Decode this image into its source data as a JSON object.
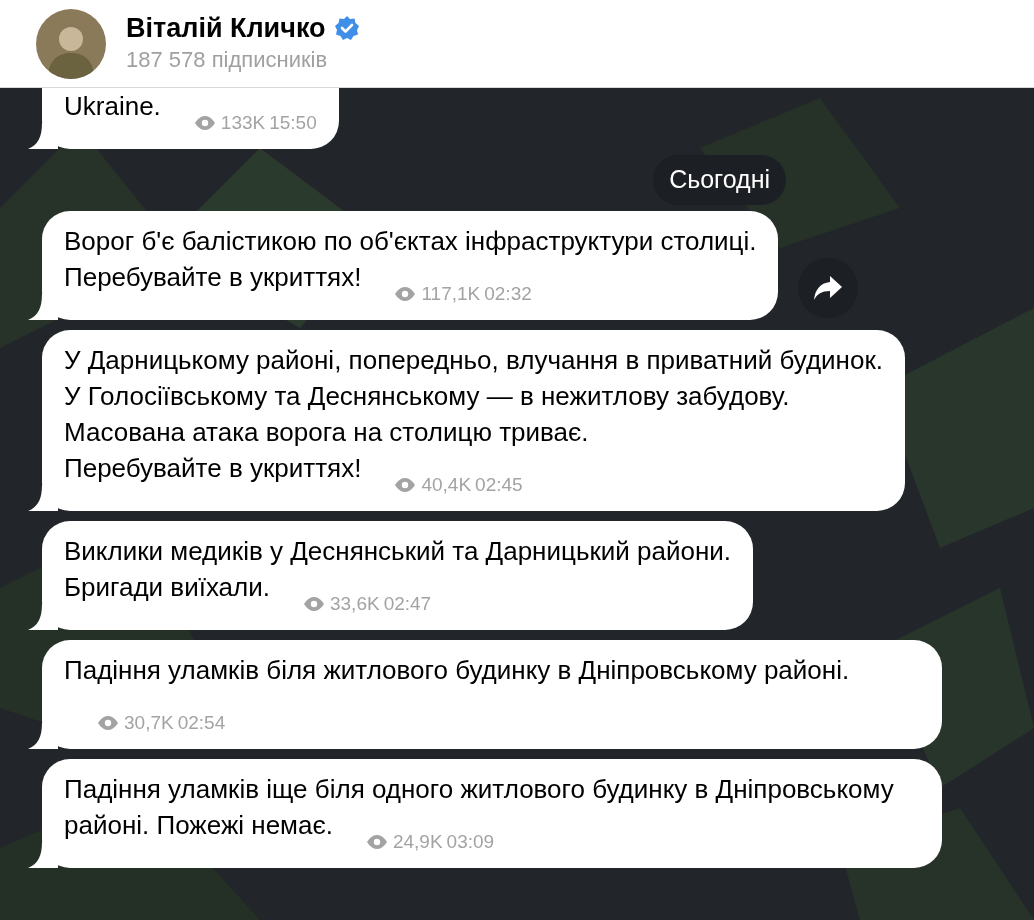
{
  "header": {
    "name": "Віталій Кличко",
    "verified": true,
    "subscribers": "187 578 підписників"
  },
  "messages": [
    {
      "text": "Ukraine.",
      "views": "133K",
      "time": "15:50",
      "cut_top": true,
      "forward": false
    },
    {
      "kind": "date",
      "text": "Сьогодні"
    },
    {
      "text": "Ворог б'є балістикою по об'єктах інфраструктури столиці.\nПеребувайте в укриттях!",
      "views": "117,1K",
      "time": "02:32",
      "cut_top": false,
      "forward": true
    },
    {
      "text": "У Дарницькому районі, попередньо, влучання в приватний будинок.\nУ Голосіївському та Деснянському — в нежитлову забудову.\nМасована атака ворога на столицю триває.\nПеребувайте в укриттях!",
      "views": "40,4K",
      "time": "02:45",
      "cut_top": false,
      "forward": false
    },
    {
      "text": "Виклики медиків у Деснянський та Дарницький райони.\nБригади виїхали.",
      "views": "33,6K",
      "time": "02:47",
      "cut_top": false,
      "forward": false
    },
    {
      "text": "Падіння уламків біля житлового будинку в Дніпровському районі.",
      "views": "30,7K",
      "time": "02:54",
      "cut_top": false,
      "forward": false
    },
    {
      "text": "Падіння уламків іще біля одного житлового будинку в Дніпровському районі. Пожежі немає.",
      "views": "24,9K",
      "time": "03:09",
      "cut_top": false,
      "forward": false
    }
  ]
}
